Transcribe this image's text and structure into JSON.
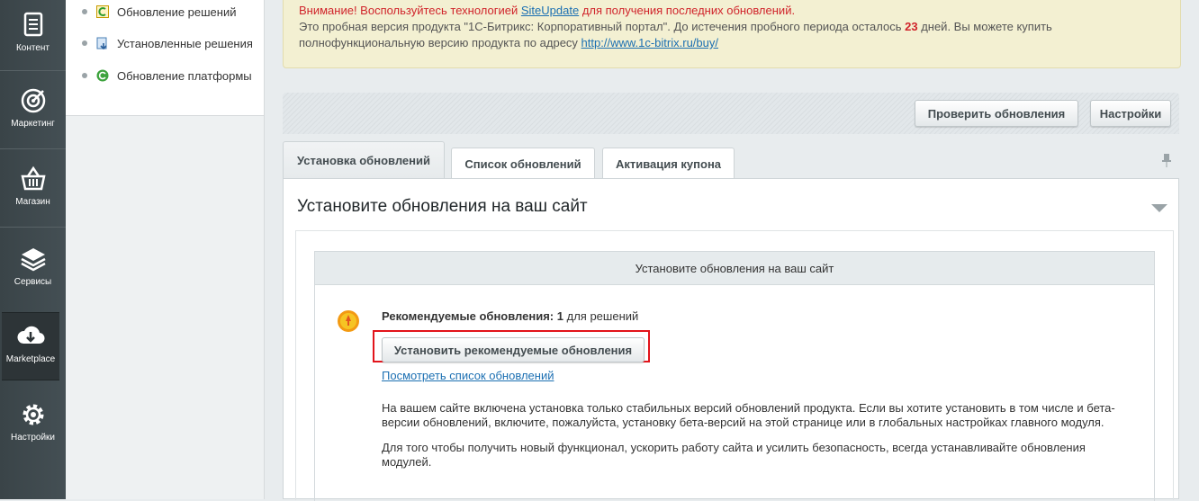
{
  "leftnav": {
    "items": [
      {
        "label": "Контент",
        "icon": "document-icon"
      },
      {
        "label": "Маркетинг",
        "icon": "target-icon"
      },
      {
        "label": "Магазин",
        "icon": "basket-icon"
      },
      {
        "label": "Сервисы",
        "icon": "layers-icon"
      },
      {
        "label": "Marketplace",
        "icon": "cloud-download-icon"
      },
      {
        "label": "Настройки",
        "icon": "gear-icon"
      }
    ]
  },
  "submenu": {
    "items": [
      {
        "label": "Обновление решений"
      },
      {
        "label": "Установленные решения"
      },
      {
        "label": "Обновление платформы"
      }
    ]
  },
  "notice": {
    "warn_prefix": "Внимание! Воспользуйтесь технологией ",
    "warn_link": "SiteUpdate",
    "warn_suffix": " для получения последних обновлений.",
    "trial_prefix": "Это пробная версия продукта \"1С-Битрикс: Корпоративный портал\". До истечения пробного периода осталось ",
    "trial_days": "23",
    "trial_suffix": " дней. Вы можете купить",
    "trial_line2": "полнофункциональную версию продукта по адресу ",
    "buy_link": "http://www.1c-bitrix.ru/buy/"
  },
  "toolbar": {
    "check_updates": "Проверить обновления",
    "settings": "Настройки"
  },
  "tabs": [
    {
      "label": "Установка обновлений"
    },
    {
      "label": "Список обновлений"
    },
    {
      "label": "Активация купона"
    }
  ],
  "panel": {
    "title": "Установите обновления на ваш сайт",
    "box_header": "Установите обновления на ваш сайт",
    "recommended_label": "Рекомендуемые обновления:",
    "recommended_count": "1",
    "recommended_suffix": "для решений",
    "install_button": "Установить рекомендуемые обновления",
    "view_list_link": "Посмотреть список обновлений",
    "para1_line1": "На вашем сайте включена установка только стабильных версий обновлений продукта. Если вы хотите установить в том числе и бета-",
    "para1_line2": "версии обновлений, включите, пожалуйста, установку бета-версий на этой странице или в глобальных настройках главного модуля.",
    "para2_line1": "Для того чтобы получить новый функционал, ускорить работу сайта и усилить безопасность, всегда устанавливайте обновления",
    "para2_line2": "модулей."
  },
  "colors": {
    "accent_link": "#1b6fb2",
    "warning_red": "#d0242b",
    "highlight_border": "#e2141b",
    "notice_bg": "#f3f0d2"
  }
}
